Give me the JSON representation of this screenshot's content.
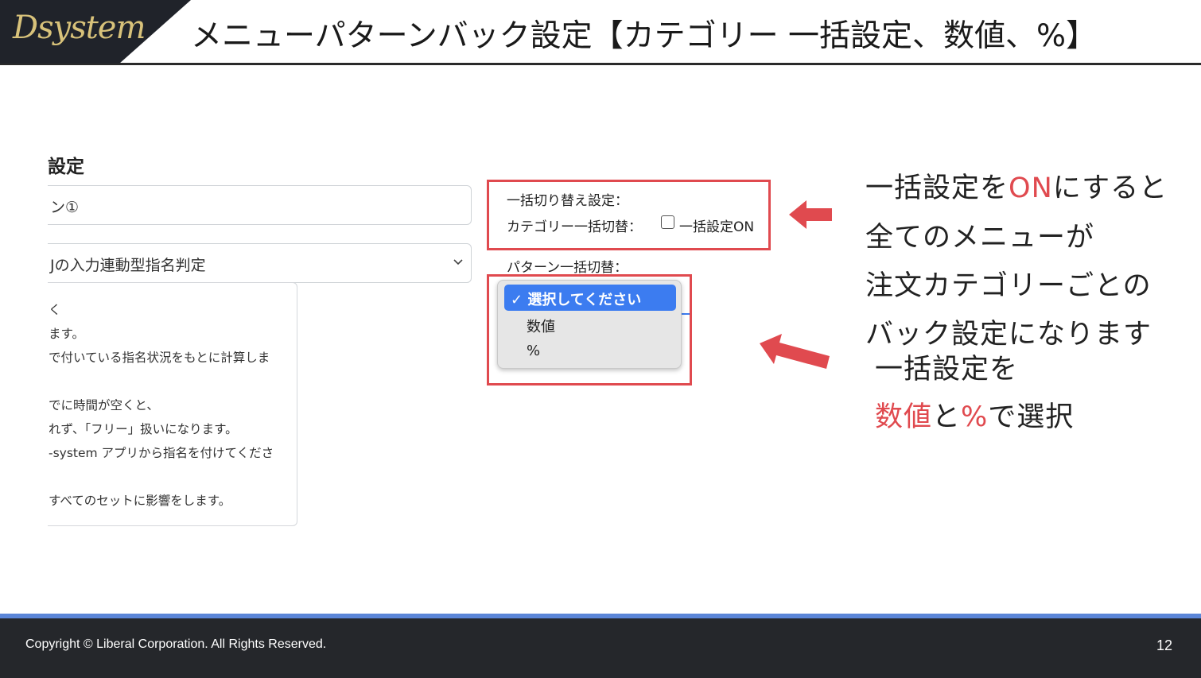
{
  "header": {
    "logo": "Dsystem",
    "title": "メニューパターンバック設定【カテゴリー 一括設定、数値、%】"
  },
  "form": {
    "section_title": "設定",
    "name_value": "ン①",
    "select_value": "Jの入力連動型指名判定",
    "info_lines": [
      "く",
      "ます。",
      "で付いている指名状況をもとに計算しま",
      "でに時間が空くと、",
      "れず、「フリー」扱いになります。",
      "-system アプリから指名を付けてくださ",
      "すべてのセットに影響をします。"
    ]
  },
  "settings": {
    "bulk_label": "一括切り替え設定：",
    "category_label": "カテゴリー一括切替：",
    "checkbox_label": "一括設定ON",
    "pattern_label": "パターン一括切替：",
    "dropdown_options": [
      "✓ 選択してください",
      "数値",
      "%"
    ]
  },
  "annotations": {
    "note1": {
      "lines": [
        {
          "a": "一括設定を",
          "b": "ON",
          "c": "にすると"
        },
        {
          "a": "全てのメニューが"
        },
        {
          "a": "注文カテゴリーごとの"
        },
        {
          "a": "バック設定になります"
        }
      ]
    },
    "note2": {
      "line1": "一括設定を",
      "line2_a": "数値",
      "line2_b": "と",
      "line2_c": "%",
      "line2_d": "で選択"
    }
  },
  "footer": {
    "copyright": "Copyright ©  Liberal Corporation. All Rights Reserved.",
    "page": "12"
  },
  "colors": {
    "accent_red": "#e04a4f",
    "select_blue": "#3c7cf0",
    "footer_bg": "#25272b",
    "footer_line": "#5b86d8"
  }
}
